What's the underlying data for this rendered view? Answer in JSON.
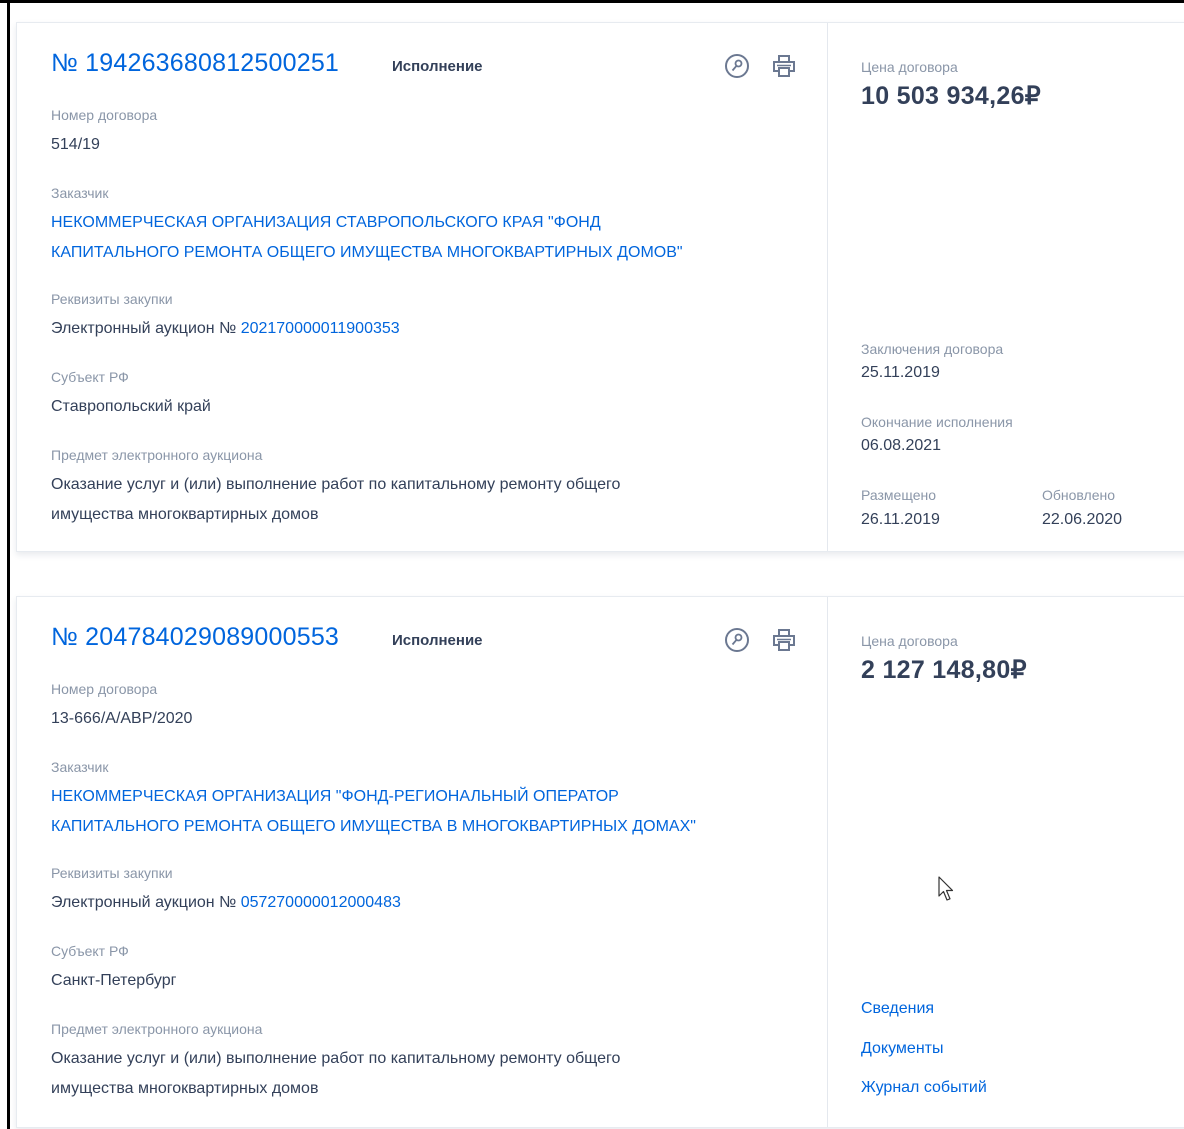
{
  "icons": {
    "info": "key-circle-icon",
    "print": "printer-icon",
    "cursor": "mouse-pointer-icon"
  },
  "colors": {
    "link": "#0065dd",
    "text": "#334059",
    "label": "#8a96a8"
  },
  "labels": {
    "contract_number": "Номер договора",
    "customer": "Заказчик",
    "purchase": "Реквизиты закупки",
    "region": "Субъект РФ",
    "subject": "Предмет электронного аукциона",
    "price": "Цена договора",
    "concluded": "Заключения договора",
    "end": "Окончание исполнения",
    "posted": "Размещено",
    "updated": "Обновлено"
  },
  "cards": [
    {
      "number": "№ 1942636808125002​51",
      "status": "Исполнение",
      "contract_number": "514/19",
      "customer_line1": "НЕКОММЕРЧЕСКАЯ ОРГАНИЗАЦИЯ СТАВРОПОЛЬСКОГО КРАЯ \"ФОНД",
      "customer_line2": "КАПИТАЛЬНОГО РЕМОНТА ОБЩЕГО ИМУЩЕСТВА МНОГОКВАРТИРНЫХ ДОМОВ\"",
      "purchase_prefix": "Электронный аукцион №",
      "purchase_number": "202170000011900353",
      "region": "Ставропольский край",
      "subject_line1": "Оказание услуг и (или) выполнение работ по капитальному ремонту общего",
      "subject_line2": "имущества многоквартирных домов",
      "price": "10 503 934,26₽",
      "concluded": "25.11.2019",
      "end": "06.08.2021",
      "posted": "26.11.2019",
      "updated": "22.06.2020"
    },
    {
      "number": "№ 204784029089000553",
      "status": "Исполнение",
      "contract_number": "13-666/А/АВР/2020",
      "customer_line1": "НЕКОММЕРЧЕСКАЯ ОРГАНИЗАЦИЯ \"ФОНД-РЕГИОНАЛЬНЫЙ ОПЕРАТОР",
      "customer_line2": "КАПИТАЛЬНОГО РЕМОНТА ОБЩЕГО ИМУЩЕСТВА В МНОГОКВАРТИРНЫХ ДОМАХ\"",
      "purchase_prefix": "Электронный аукцион №",
      "purchase_number": "057270000012000483",
      "region": "Санкт-Петербург",
      "subject_line1": "Оказание услуг и (или) выполнение работ по капитальному ремонту общего",
      "subject_line2": "имущества многоквартирных домов",
      "price": "2 127 148,80₽",
      "links": [
        "Сведения",
        "Документы",
        "Журнал событий"
      ]
    }
  ]
}
